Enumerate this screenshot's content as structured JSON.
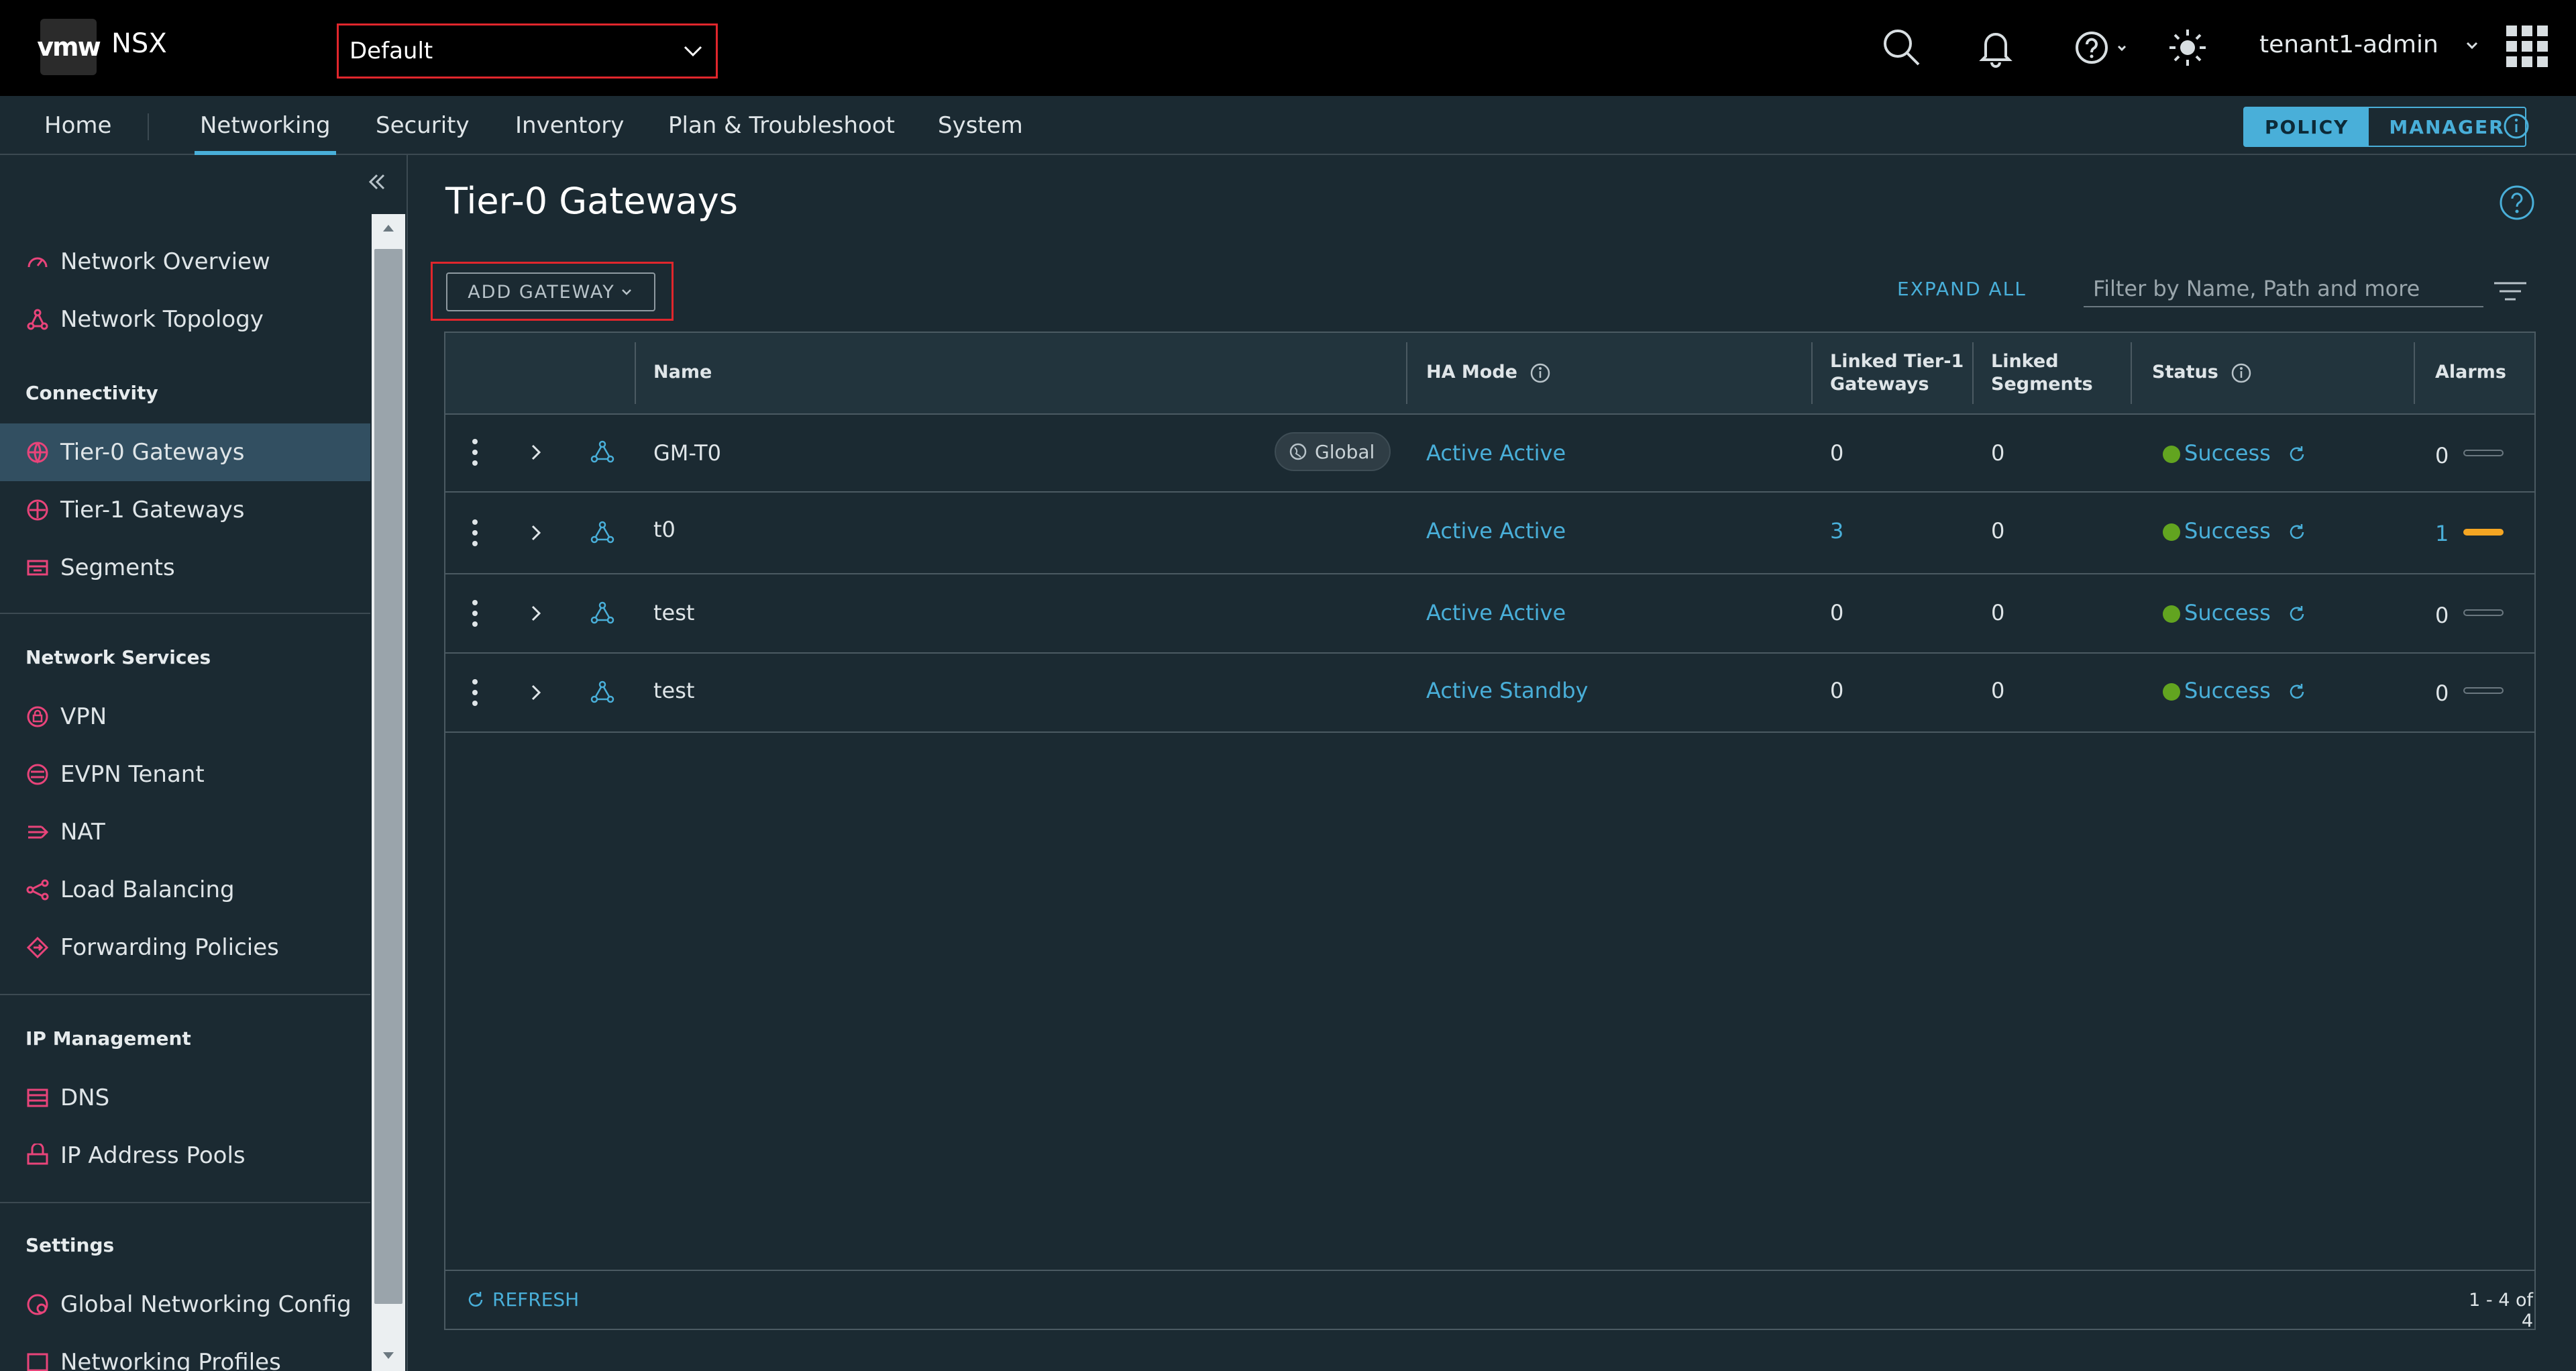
{
  "header": {
    "logo": "vmw",
    "app_name": "NSX",
    "project": "Default",
    "user": "tenant1-admin"
  },
  "nav": {
    "tabs": [
      "Home",
      "Networking",
      "Security",
      "Inventory",
      "Plan & Troubleshoot",
      "System"
    ],
    "active_tab": "Networking",
    "mode_policy": "POLICY",
    "mode_manager": "MANAGER"
  },
  "sidebar": {
    "top_items": [
      "Network Overview",
      "Network Topology"
    ],
    "connectivity_title": "Connectivity",
    "connectivity_items": [
      "Tier-0 Gateways",
      "Tier-1 Gateways",
      "Segments"
    ],
    "network_services_title": "Network Services",
    "network_services_items": [
      "VPN",
      "EVPN Tenant",
      "NAT",
      "Load Balancing",
      "Forwarding Policies"
    ],
    "ip_management_title": "IP Management",
    "ip_management_items": [
      "DNS",
      "IP Address Pools"
    ],
    "settings_title": "Settings",
    "settings_items": [
      "Global Networking Config",
      "Networking Profiles"
    ],
    "active_item": "Tier-0 Gateways"
  },
  "main": {
    "title": "Tier-0 Gateways",
    "add_gateway": "ADD GATEWAY",
    "expand_all": "EXPAND ALL",
    "filter_placeholder": "Filter by Name, Path and more"
  },
  "grid": {
    "columns": {
      "name": "Name",
      "ha_mode": "HA Mode",
      "linked_t1_line1": "Linked Tier-1",
      "linked_t1_line2": "Gateways",
      "linked_seg_line1": "Linked",
      "linked_seg_line2": "Segments",
      "status": "Status",
      "alarms": "Alarms"
    },
    "rows": [
      {
        "name": "GM-T0",
        "badge": "Global",
        "ha_mode": "Active Active",
        "linked_t1": "0",
        "linked_segments": "0",
        "status": "Success",
        "alarms": "0"
      },
      {
        "name": "t0",
        "badge": "",
        "ha_mode": "Active Active",
        "linked_t1": "3",
        "linked_segments": "0",
        "status": "Success",
        "alarms": "1"
      },
      {
        "name": "test",
        "badge": "",
        "ha_mode": "Active Active",
        "linked_t1": "0",
        "linked_segments": "0",
        "status": "Success",
        "alarms": "0"
      },
      {
        "name": "test",
        "badge": "",
        "ha_mode": "Active Standby",
        "linked_t1": "0",
        "linked_segments": "0",
        "status": "Success",
        "alarms": "0"
      }
    ],
    "refresh": "REFRESH",
    "pagination": "1 - 4 of 4"
  },
  "colors": {
    "accent": "#49afd9",
    "success": "#62a420",
    "alarm_active": "#f5a623",
    "highlight_box": "#e0262c",
    "sidebar_icon": "#e8447a"
  }
}
